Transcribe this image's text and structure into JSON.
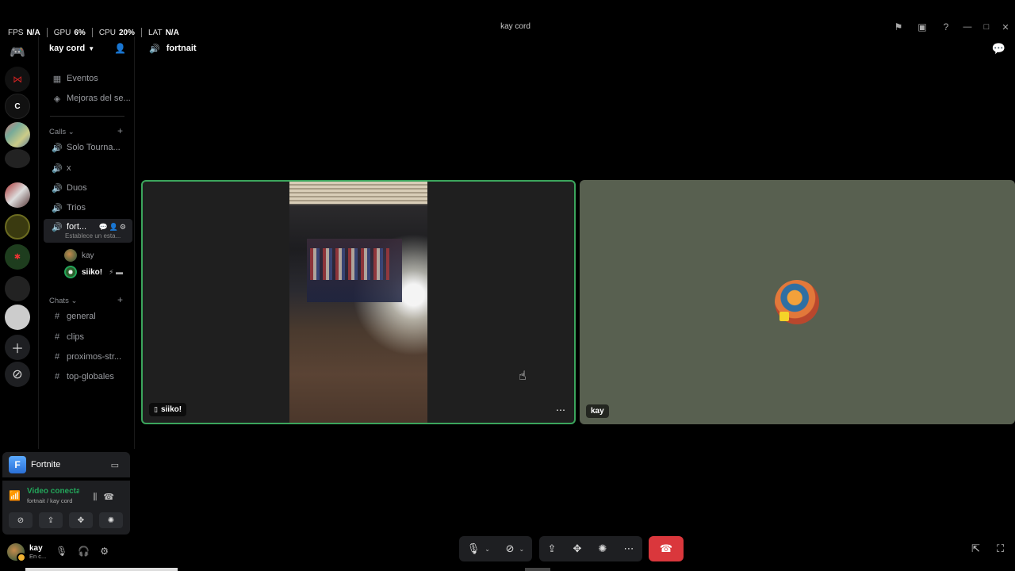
{
  "overlay": {
    "stats": [
      {
        "label": "FPS",
        "value": "N/A"
      },
      {
        "label": "GPU",
        "value": "6%"
      },
      {
        "label": "CPU",
        "value": "20%"
      },
      {
        "label": "LAT",
        "value": "N/A"
      }
    ]
  },
  "window": {
    "title": "kay cord"
  },
  "server": {
    "name": "kay cord"
  },
  "sidebar": {
    "top_items": [
      {
        "label": "Eventos",
        "icon": "calendar-icon"
      },
      {
        "label": "Mejoras del se...",
        "icon": "boost-icon"
      }
    ],
    "calls_category": "Calls",
    "voice_channels": [
      "Solo Tourna...",
      "x",
      "Duos",
      "Trios"
    ],
    "active_channel": {
      "label": "fort...",
      "subtitle": "Establece un esta..."
    },
    "voice_users": [
      {
        "name": "kay"
      },
      {
        "name": "siiko!"
      }
    ],
    "chats_category": "Chats",
    "text_channels": [
      "general",
      "clips",
      "proximos-str...",
      "top-globales"
    ]
  },
  "activity": {
    "name": "Fortnite"
  },
  "voice_panel": {
    "status": "Video conecta",
    "location": "fortnait / kay cord"
  },
  "user": {
    "name": "kay",
    "status": "En c..."
  },
  "channel": {
    "name": "fortnait"
  },
  "tiles": [
    {
      "name": "siiko!"
    },
    {
      "name": "kay"
    }
  ],
  "colors": {
    "speaking": "#3ba55c",
    "hangup": "#da373c",
    "tile_bg_kay": "#586050"
  }
}
